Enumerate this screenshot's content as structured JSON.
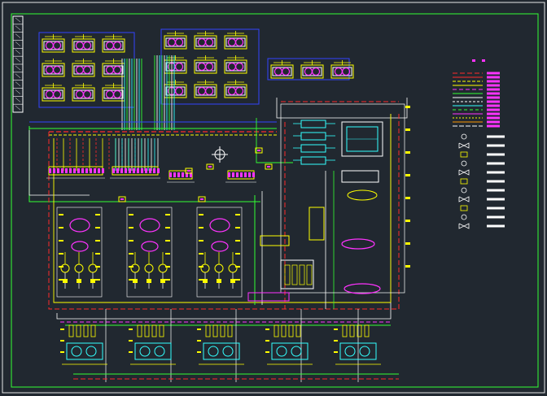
{
  "drawing": {
    "background": "#212830",
    "palette": {
      "frame": "#33ff33",
      "white": "#ffffff",
      "red": "#ff2a2a",
      "yellow": "#ffff00",
      "magenta": "#ff33ff",
      "cyan": "#33ffff",
      "blue": "#3344ff",
      "green": "#33ff33",
      "orange": "#ff9900"
    },
    "title_block": {
      "rows": 12
    },
    "equipment": {
      "top_left_units": {
        "rows": 3,
        "cols": 3
      },
      "top_mid_units": {
        "rows": 3,
        "cols": 3
      },
      "top_right_units": {
        "rows": 1,
        "cols": 3
      },
      "bottom_units": 5,
      "pump_groups": 3,
      "tanks": 4
    },
    "legend": {
      "title": "",
      "line_types": [
        {
          "color": "#ff2a2a",
          "dash": "6 3"
        },
        {
          "color": "#ff2a2a",
          "dash": ""
        },
        {
          "color": "#ffff00",
          "dash": "4 2"
        },
        {
          "color": "#ffff00",
          "dash": ""
        },
        {
          "color": "#ff33ff",
          "dash": "5 3"
        },
        {
          "color": "#33ff33",
          "dash": ""
        },
        {
          "color": "#ffffff",
          "dash": ""
        },
        {
          "color": "#ffffff",
          "dash": "3 2"
        },
        {
          "color": "#33ffff",
          "dash": ""
        },
        {
          "color": "#33ff33",
          "dash": "4 3"
        },
        {
          "color": "#ff33ff",
          "dash": ""
        },
        {
          "color": "#ffff00",
          "dash": "2 2"
        },
        {
          "color": "#ff9900",
          "dash": ""
        },
        {
          "color": "#ffffff",
          "dash": "6 2"
        }
      ],
      "symbols": [
        "valve-symbol",
        "gate-valve-symbol",
        "check-valve-symbol",
        "globe-valve-symbol",
        "strainer-symbol",
        "pump-symbol",
        "gauge-symbol",
        "thermometer-symbol",
        "flow-switch-symbol",
        "meter-symbol",
        "filter-symbol"
      ]
    }
  }
}
